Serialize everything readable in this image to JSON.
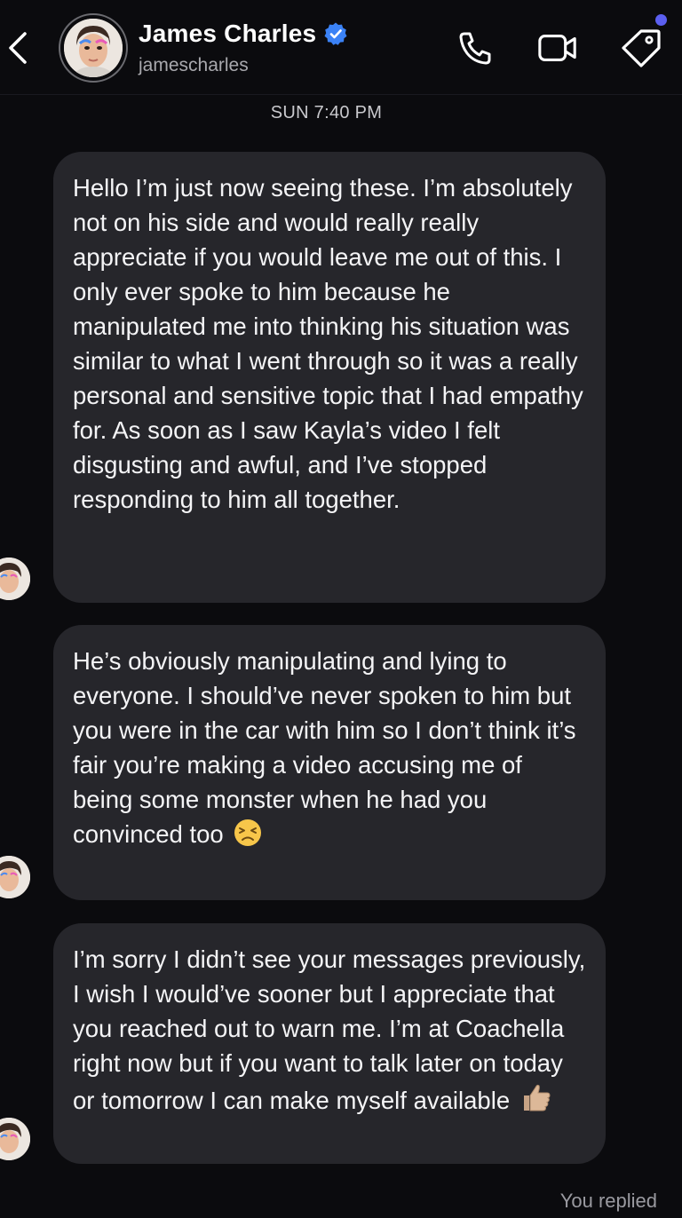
{
  "header": {
    "contact_name": "James Charles",
    "handle": "jamescharles",
    "verified": true,
    "icons": {
      "back": "chevron-left-icon",
      "call": "phone-icon",
      "video": "video-camera-icon",
      "tag": "tag-icon",
      "verified": "verified-badge-icon"
    },
    "notification_dot_color": "#5b5ff0",
    "verified_color": "#3b82f6"
  },
  "thread": {
    "timestamp": "SUN 7:40 PM",
    "messages": [
      {
        "text": "Hello I’m just now seeing these. I’m absolutely not on his side and would really really appreciate if you would leave me out of this. I only ever spoke to him because he manipulated me into thinking his situation was similar to what I went through so it was a really personal and sensitive topic that I had empathy for. As soon as I saw Kayla’s video I felt disgusting and awful, and I’ve stopped responding to him all together.",
        "emoji": ""
      },
      {
        "text": "He’s obviously manipulating and lying to everyone. I should’ve never spoken to him but you were in the car with him so I don’t think it’s fair you’re making a video accusing me of being some monster when he had you convinced too",
        "emoji": "persevering-face-emoji"
      },
      {
        "text": "I’m sorry I didn’t see your messages previously, I wish I would’ve sooner but I appreciate that you reached out to warn me. I’m at Coachella right now but if you want to talk later on today or tomorrow I can make myself available",
        "emoji": "thumbs-up-emoji"
      }
    ],
    "footer_status": "You replied"
  },
  "colors": {
    "background": "#0b0b0e",
    "bubble": "#26262b",
    "text": "#f4f4f6",
    "muted": "#a8a8ad"
  }
}
